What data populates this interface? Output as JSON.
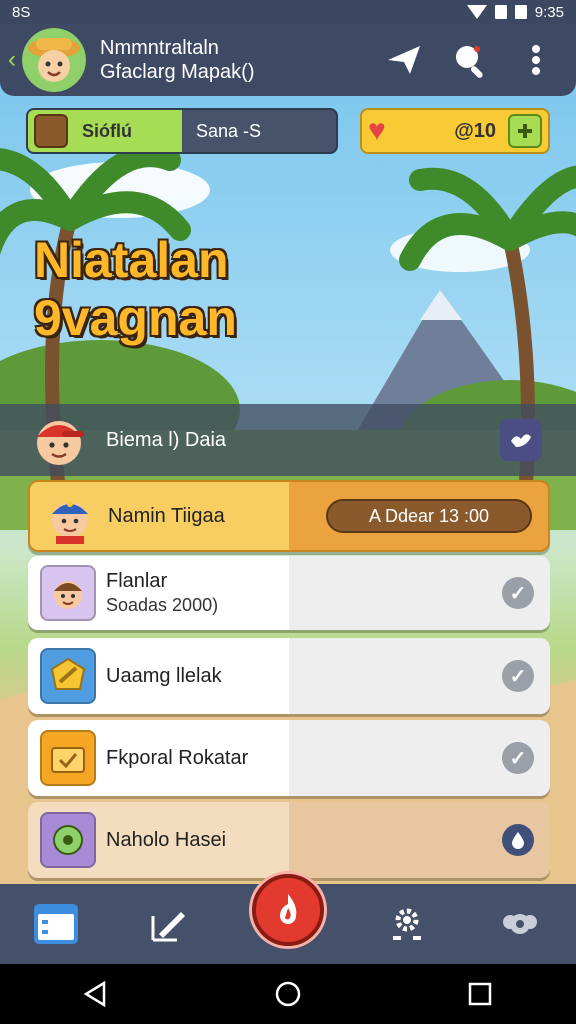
{
  "status_bar": {
    "left": "8S",
    "time": "9:35"
  },
  "header": {
    "title": "Nmmntraltaln",
    "subtitle": "Gfaclarg Mapak()"
  },
  "currency": {
    "left_label": "Sióflú",
    "left_value": "Sana -S",
    "right_value": "@10"
  },
  "game_title": {
    "line1": "Niatalan",
    "line2": "9vagnan"
  },
  "featured": {
    "label": "Biema l) Daia"
  },
  "cards": [
    {
      "title": "Namin Tiigaa",
      "timer": "A Ddear 13 :00"
    },
    {
      "title": "Flanlar",
      "subtitle": "Soadas 2000)"
    },
    {
      "title": "Uaamg llelak"
    },
    {
      "title": "Fkporal Rokatar"
    },
    {
      "title": "Naholo Hasei"
    }
  ],
  "colors": {
    "header_bg": "#3e4a63",
    "accent_green": "#a7dd55",
    "accent_yellow": "#f8cb35",
    "accent_orange": "#eba33f",
    "title_orange": "#ffb82a",
    "nav_center_red": "#e23a2e"
  }
}
